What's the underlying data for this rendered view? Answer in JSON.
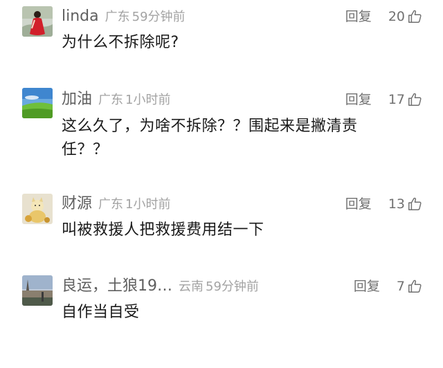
{
  "comments": [
    {
      "username": "linda",
      "location": "广东",
      "time": "59分钟前",
      "reply_label": "回复",
      "likes": "20",
      "text": "为什么不拆除呢?",
      "avatar_icon": "avatar-red-dress-photo"
    },
    {
      "username": "加油",
      "location": "广东",
      "time": "1小时前",
      "reply_label": "回复",
      "likes": "17",
      "text": "这么久了，为啥不拆除？？围起来是撇清责任？？",
      "avatar_icon": "avatar-grass-field-photo"
    },
    {
      "username": "财源",
      "location": "广东",
      "time": "1小时前",
      "reply_label": "回复",
      "likes": "13",
      "text": "叫被救援人把救援费用结一下",
      "avatar_icon": "avatar-lucky-cat-photo"
    },
    {
      "username": "良运，土狼19…",
      "location": "云南",
      "time": "59分钟前",
      "reply_label": "回复",
      "likes": "7",
      "text": "自作当自受",
      "avatar_icon": "avatar-street-photo"
    }
  ],
  "icons": {
    "like": "thumbs-up-icon"
  },
  "colors": {
    "username": "#5f5f5f",
    "meta": "#a3a3a3",
    "body_text": "#1a1a1a"
  }
}
